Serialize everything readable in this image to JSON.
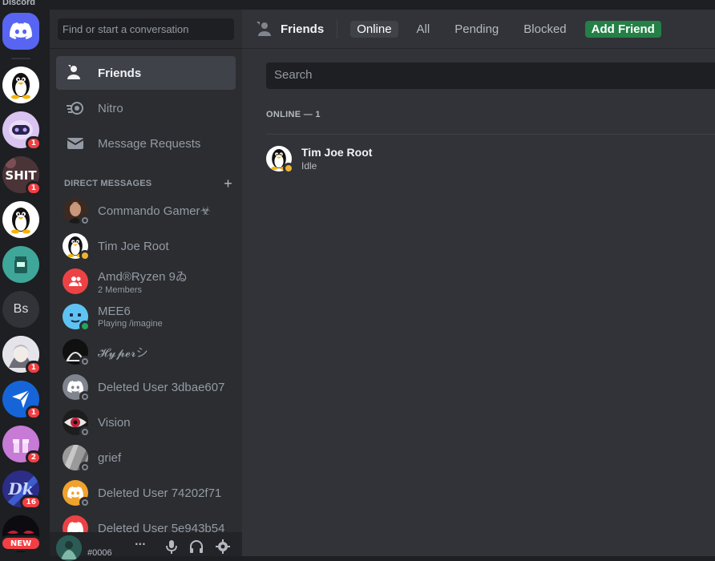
{
  "app": {
    "title": "Discord"
  },
  "rail": {
    "servers": [
      {
        "name": "tux-server-1",
        "badge": ""
      },
      {
        "name": "robot-server",
        "badge": "1"
      },
      {
        "name": "shit-server",
        "badge": "1"
      },
      {
        "name": "tux-server-2",
        "badge": ""
      },
      {
        "name": "teal-server",
        "badge": ""
      },
      {
        "name": "bs-server",
        "initials": "Bs",
        "badge": ""
      },
      {
        "name": "anime-server",
        "badge": "1"
      },
      {
        "name": "blue-arrow-server",
        "badge": "1"
      },
      {
        "name": "gift-server",
        "badge": "2"
      },
      {
        "name": "dk-server",
        "badge": "16"
      },
      {
        "name": "eyes-server",
        "badge": ""
      }
    ],
    "new_label": "NEW"
  },
  "sidebar": {
    "search_placeholder": "Find or start a conversation",
    "nav": {
      "friends": "Friends",
      "nitro": "Nitro",
      "requests": "Message Requests"
    },
    "dm_header": "DIRECT MESSAGES",
    "dm_add": "+",
    "dms": [
      {
        "name": "Commando Gamer☣",
        "sub": "",
        "status": "offline"
      },
      {
        "name": "Tim Joe Root",
        "sub": "",
        "status": "idle"
      },
      {
        "name": "Amd®Ryzen 9ゐ",
        "sub": "2 Members",
        "status": ""
      },
      {
        "name": "MEE6",
        "sub": "Playing /imagine",
        "status": "online"
      },
      {
        "name": "𝓗𝔂𝓹𝓮𝓻シ",
        "sub": "",
        "status": "offline"
      },
      {
        "name": "Deleted User 3dbae607",
        "sub": "",
        "status": "offline"
      },
      {
        "name": "Vision",
        "sub": "",
        "status": "offline"
      },
      {
        "name": "grief",
        "sub": "",
        "status": "offline"
      },
      {
        "name": "Deleted User 74202f71",
        "sub": "",
        "status": "offline"
      },
      {
        "name": "Deleted User 5e943b54",
        "sub": "",
        "status": ""
      }
    ]
  },
  "userpanel": {
    "tag": "#0006",
    "more": "···"
  },
  "main": {
    "title": "Friends",
    "tabs": {
      "online": "Online",
      "all": "All",
      "pending": "Pending",
      "blocked": "Blocked",
      "add": "Add Friend"
    },
    "search_placeholder": "Search",
    "online_header": "ONLINE — 1",
    "friend": {
      "name": "Tim Joe Root",
      "status": "Idle"
    }
  },
  "colors": {
    "blurple": "#5865f2",
    "green": "#248046",
    "red": "#f23f43",
    "idle": "#f0b232",
    "online": "#23a55a"
  }
}
